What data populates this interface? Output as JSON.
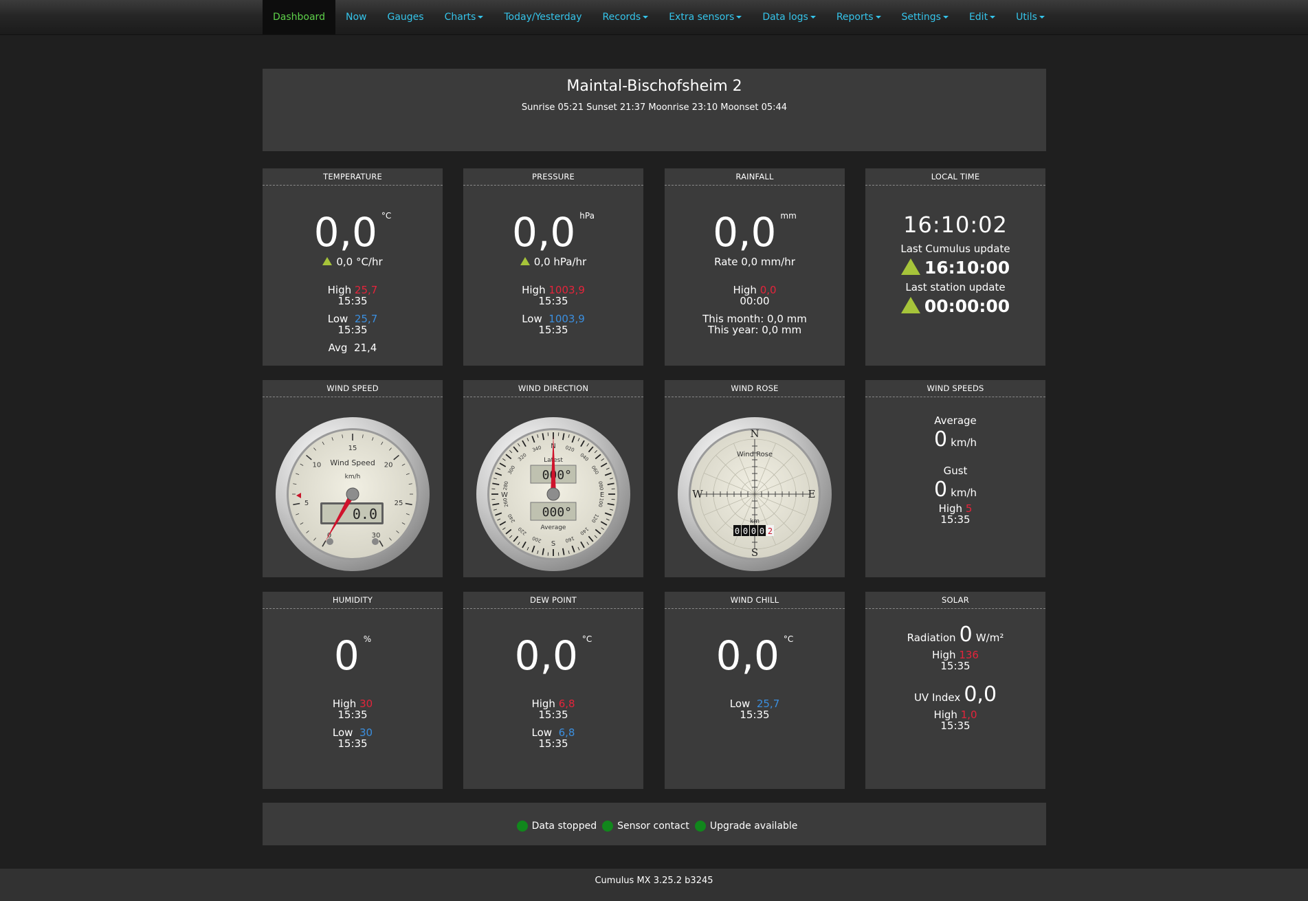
{
  "nav": {
    "items": [
      {
        "label": "Dashboard",
        "active": true,
        "dropdown": false
      },
      {
        "label": "Now",
        "active": false,
        "dropdown": false
      },
      {
        "label": "Gauges",
        "active": false,
        "dropdown": false
      },
      {
        "label": "Charts",
        "active": false,
        "dropdown": true
      },
      {
        "label": "Today/Yesterday",
        "active": false,
        "dropdown": false
      },
      {
        "label": "Records",
        "active": false,
        "dropdown": true
      },
      {
        "label": "Extra sensors",
        "active": false,
        "dropdown": true
      },
      {
        "label": "Data logs",
        "active": false,
        "dropdown": true
      },
      {
        "label": "Reports",
        "active": false,
        "dropdown": true
      },
      {
        "label": "Settings",
        "active": false,
        "dropdown": true
      },
      {
        "label": "Edit",
        "active": false,
        "dropdown": true
      },
      {
        "label": "Utils",
        "active": false,
        "dropdown": true
      }
    ]
  },
  "header": {
    "station_name": "Maintal-Bischofsheim 2",
    "astro": "Sunrise 05:21 Sunset 21:37 Moonrise 23:10 Moonset 05:44"
  },
  "temperature": {
    "title": "TEMPERATURE",
    "value": "0,0",
    "unit": "°C",
    "trend": "0,0 °C/hr",
    "high_label": "High",
    "high": "25,7",
    "high_time": "15:35",
    "low_label": "Low",
    "low": "25,7",
    "low_time": "15:35",
    "avg_label": "Avg",
    "avg": "21,4"
  },
  "pressure": {
    "title": "PRESSURE",
    "value": "0,0",
    "unit": "hPa",
    "trend": "0,0 hPa/hr",
    "high_label": "High",
    "high": "1003,9",
    "high_time": "15:35",
    "low_label": "Low",
    "low": "1003,9",
    "low_time": "15:35"
  },
  "rainfall": {
    "title": "RAINFALL",
    "value": "0,0",
    "unit": "mm",
    "rate": "Rate 0,0 mm/hr",
    "high_label": "High",
    "high": "0,0",
    "high_time": "00:00",
    "month": "This month: 0,0 mm",
    "year": "This year: 0,0 mm"
  },
  "local_time": {
    "title": "LOCAL TIME",
    "time": "16:10:02",
    "cumulus_label": "Last Cumulus update",
    "cumulus_time": "16:10:00",
    "station_label": "Last station update",
    "station_time": "00:00:00"
  },
  "wind_speed_gauge": {
    "title": "WIND SPEED",
    "label": "Wind Speed",
    "unit": "km/h",
    "lcd": "0.0",
    "ticks": [
      "0",
      "5",
      "10",
      "15",
      "20",
      "25",
      "30"
    ],
    "value": 0,
    "max": 30
  },
  "wind_direction_gauge": {
    "title": "WIND DIRECTION",
    "latest_label": "Latest",
    "latest": "000°",
    "average_label": "Average",
    "average": "000°",
    "cardinals": [
      "N",
      "E",
      "S",
      "W"
    ],
    "degree_labels": [
      "020",
      "040",
      "060",
      "080",
      "100",
      "120",
      "140",
      "160",
      "180",
      "200",
      "220",
      "240",
      "260",
      "280",
      "300",
      "320",
      "340"
    ],
    "value": 0
  },
  "wind_rose": {
    "title": "WIND ROSE",
    "label": "Wind Rose",
    "unit": "km",
    "odometer": [
      "0",
      "0",
      "0",
      "0",
      "2"
    ],
    "cardinals": [
      "N",
      "E",
      "S",
      "W"
    ]
  },
  "wind_speeds": {
    "title": "WIND SPEEDS",
    "average_label": "Average",
    "average": "0",
    "average_unit": "km/h",
    "gust_label": "Gust",
    "gust": "0",
    "gust_unit": "km/h",
    "high_label": "High",
    "high": "5",
    "high_time": "15:35"
  },
  "humidity": {
    "title": "HUMIDITY",
    "value": "0",
    "unit": "%",
    "high_label": "High",
    "high": "30",
    "high_time": "15:35",
    "low_label": "Low",
    "low": "30",
    "low_time": "15:35"
  },
  "dew_point": {
    "title": "DEW POINT",
    "value": "0,0",
    "unit": "°C",
    "high_label": "High",
    "high": "6,8",
    "high_time": "15:35",
    "low_label": "Low",
    "low": "6,8",
    "low_time": "15:35"
  },
  "wind_chill": {
    "title": "WIND CHILL",
    "value": "0,0",
    "unit": "°C",
    "low_label": "Low",
    "low": "25,7",
    "low_time": "15:35"
  },
  "solar": {
    "title": "SOLAR",
    "radiation_label": "Radiation",
    "radiation": "0",
    "radiation_unit": "W/m²",
    "rad_high_label": "High",
    "rad_high": "136",
    "rad_high_time": "15:35",
    "uv_label": "UV Index",
    "uv": "0,0",
    "uv_high_label": "High",
    "uv_high": "1,0",
    "uv_high_time": "15:35"
  },
  "status": {
    "data_stopped": "Data stopped",
    "sensor_contact": "Sensor contact",
    "upgrade": "Upgrade available",
    "led_color": "#11871c"
  },
  "footer": {
    "version": "Cumulus MX 3.25.2 b3245"
  },
  "colors": {
    "accent_link": "#35c4ea",
    "active_nav": "#5ed14a",
    "high": "#e5243b",
    "low": "#3b8fe0",
    "trend": "#a6c43a",
    "panel": "#3b3b3b"
  }
}
